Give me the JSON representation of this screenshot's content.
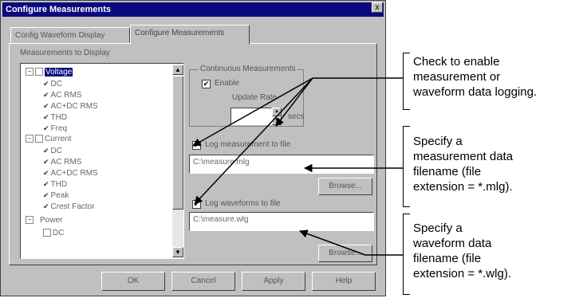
{
  "dialog": {
    "title": "Configure Measurements",
    "close": "x",
    "tabs": [
      "Config Waveform Display",
      "Configure Measurements"
    ]
  },
  "tree": {
    "label": "Measurements to Display",
    "items": [
      {
        "text": "Voltage",
        "type": "group"
      },
      {
        "text": "DC",
        "type": "checked"
      },
      {
        "text": "AC RMS",
        "type": "checked"
      },
      {
        "text": "AC+DC RMS",
        "type": "checked"
      },
      {
        "text": "THD",
        "type": "checked"
      },
      {
        "text": "Freq",
        "type": "checked"
      },
      {
        "text": "Current",
        "type": "group"
      },
      {
        "text": "DC",
        "type": "checked"
      },
      {
        "text": "AC RMS",
        "type": "checked"
      },
      {
        "text": "AC+DC RMS",
        "type": "checked"
      },
      {
        "text": "THD",
        "type": "checked"
      },
      {
        "text": "Peak",
        "type": "checked"
      },
      {
        "text": "Crest Factor",
        "type": "checked"
      },
      {
        "text": "Power",
        "type": "group"
      },
      {
        "text": "DC",
        "type": "unchecked"
      }
    ]
  },
  "continuous": {
    "group_label": "Continuous Measurements",
    "enable_label": "Enable",
    "update_rate_label": "Update Rate",
    "update_rate_unit": "secs"
  },
  "log_measurement": {
    "label": "Log measurement to file",
    "value": "C:\\measure.mlg",
    "browse": "Browse..."
  },
  "log_waveform": {
    "label": "Log waveforms to file",
    "value": "C:\\measure.wlg",
    "browse": "Browse..."
  },
  "buttons": {
    "ok": "OK",
    "cancel": "Cancel",
    "apply": "Apply",
    "help": "Help"
  },
  "callouts": {
    "enable": [
      "Check to enable",
      "measurement or",
      "waveform data logging."
    ],
    "measurement_file": [
      "Specify a",
      "measurement data",
      "filename (file",
      "extension = *.mlg)."
    ],
    "waveform_file": [
      "Specify a",
      "waveform data",
      "filename (file",
      "extension = *.wlg)."
    ]
  }
}
